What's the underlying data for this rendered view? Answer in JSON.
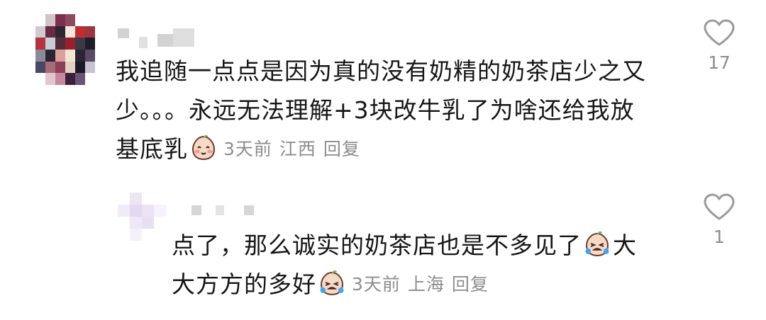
{
  "comments": [
    {
      "line1": "我追随一点点是因为真的没有奶精的奶茶店少之又",
      "line2": "少。。。永远无法理解+3块改牛乳了为啥还给我放",
      "line3": "基底乳",
      "emoji": "smiling-blush-emoji",
      "time": "3天前",
      "location": "江西",
      "reply_label": "回复",
      "likes": "17",
      "icons": {
        "like": "heart-outline-icon"
      }
    }
  ],
  "reply": {
    "line1_a": "点了，那么诚实的奶茶店也是不多见了",
    "line1_b": "大",
    "line2": "大方方的多好",
    "emoji": "crying-emoji",
    "time": "3天前",
    "location": "上海",
    "reply_label": "回复",
    "likes": "1",
    "icons": {
      "like": "heart-outline-icon"
    }
  },
  "colors": {
    "text": "#161616",
    "meta": "#8d8d8d",
    "icon": "#9a9a9a"
  }
}
